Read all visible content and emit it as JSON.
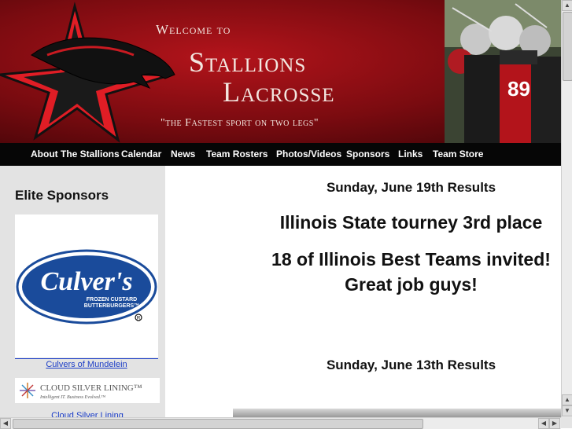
{
  "header": {
    "welcome": "Welcome to",
    "title_line1": "Stallions",
    "title_line2": "Lacrosse",
    "tagline": "\"the Fastest sport on two legs\""
  },
  "nav": {
    "items": [
      "About The Stallions",
      "Calendar",
      "News",
      "Team Rosters",
      "Photos/Videos",
      "Sponsors",
      "Links",
      "Team Store"
    ]
  },
  "sidebar": {
    "title": "Elite Sponsors",
    "sponsor1": {
      "logo_text": "Culver's",
      "logo_subtext1": "FROZEN CUSTARD",
      "logo_subtext2": "BUTTERBURGERS™",
      "link": "Culvers of Mundelein"
    },
    "sponsor2": {
      "logo_text": "CLOUD SILVER LINING™",
      "logo_subtext": "Intelligent IT. Business Evolved.™",
      "link": "Cloud Silver Lining"
    }
  },
  "main": {
    "heading1": "Sunday, June 19th Results",
    "line1": "Illinois State tourney 3rd place",
    "line2": "18 of Illinois Best Teams invited!",
    "line3": "Great job guys!",
    "heading2": "Sunday, June 13th Results"
  },
  "photo": {
    "jersey_number": "89"
  },
  "colors": {
    "nav_bg": "#060606",
    "header_red": "#b3141b",
    "link": "#1a3cc7",
    "sidebar_bg": "#e3e3e3"
  }
}
